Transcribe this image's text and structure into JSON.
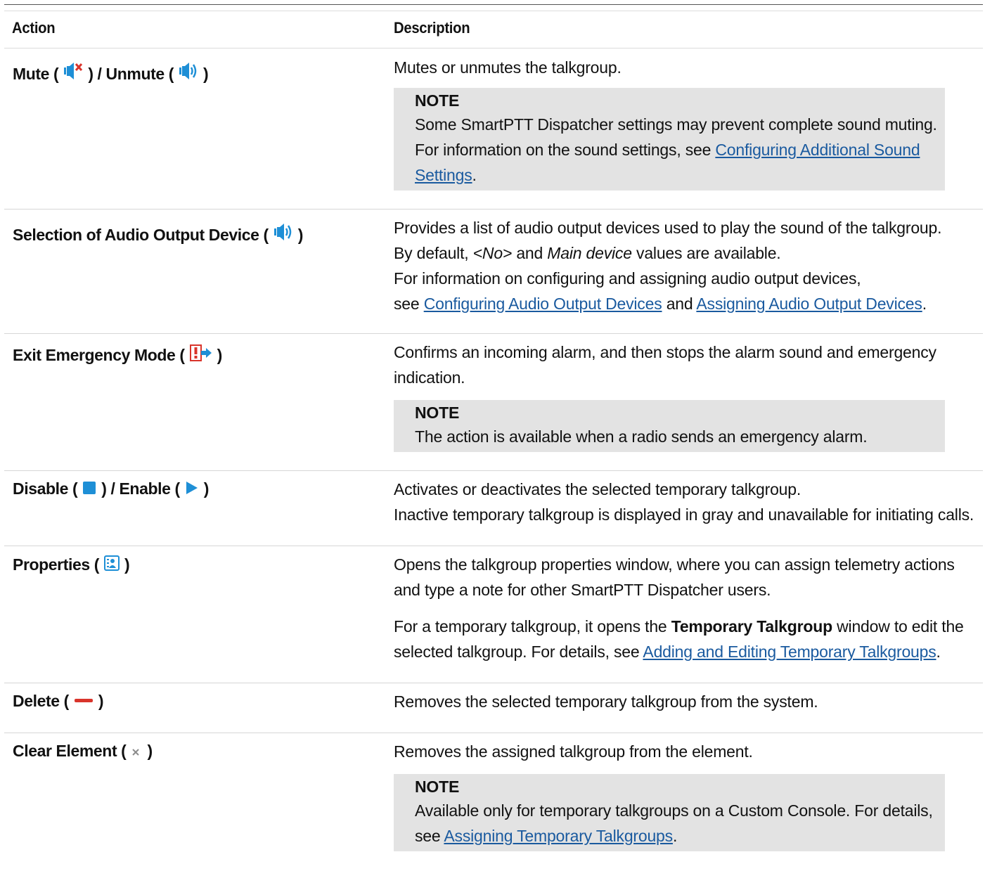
{
  "table": {
    "header": {
      "action": "Action",
      "description": "Description"
    },
    "rows": {
      "mute": {
        "action_a": "Mute (",
        "action_b": ") / Unmute (",
        "action_c": ")",
        "desc": "Mutes or unmutes the talkgroup.",
        "note_title": "NOTE",
        "note_text_1": "Some SmartPTT Dispatcher settings may prevent complete sound muting. For information on the sound settings, see ",
        "note_link": "Configuring Additional Sound Settings",
        "note_text_2": "."
      },
      "audio": {
        "action_a": "Selection of Audio Output Device (",
        "action_b": ")",
        "line1": "Provides a list of audio output devices used to play the sound of the talkgroup.",
        "line2_a": "By default, ",
        "line2_b": "<No>",
        "line2_c": " and ",
        "line2_d": "Main device",
        "line2_e": " values are available.",
        "line3": "For information on configuring and assigning audio output devices,",
        "line4_a": "see ",
        "link1": "Configuring Audio Output Devices",
        "line4_b": " and ",
        "link2": "Assigning Audio Output Devices",
        "line4_c": "."
      },
      "emergency": {
        "action_a": "Exit Emergency Mode (",
        "action_b": ")",
        "desc": "Confirms an incoming alarm, and then stops the alarm sound and emergency indication.",
        "note_title": "NOTE",
        "note_text": "The action is available when a radio sends an emergency alarm."
      },
      "disable": {
        "action_a": "Disable (",
        "action_b": ") / Enable (",
        "action_c": ")",
        "line1": "Activates or deactivates the selected temporary talkgroup.",
        "line2": "Inactive temporary talkgroup is displayed in gray and unavailable for initiating calls."
      },
      "properties": {
        "action_a": "Properties (",
        "action_b": ")",
        "para1": "Opens the talkgroup properties window, where you can assign telemetry actions and type a note for other SmartPTT Dispatcher users.",
        "para2_a": "For a temporary talkgroup, it opens the ",
        "para2_bold": "Temporary Talkgroup",
        "para2_b": " window to edit the selected talkgroup. For details, see ",
        "para2_link": "Adding and Editing Temporary Talkgroups",
        "para2_c": "."
      },
      "delete": {
        "action_a": "Delete (",
        "action_b": ")",
        "desc": "Removes the selected temporary talkgroup from the system."
      },
      "clear": {
        "action_a": "Clear Element (",
        "action_b": ")",
        "desc": "Removes the assigned talkgroup from the element.",
        "note_title": "NOTE",
        "note_text_1": "Available only for temporary talkgroups on a Custom Console. For details, see ",
        "note_link": "Assigning Temporary Talkgroups",
        "note_text_2": "."
      }
    }
  },
  "icons": {
    "mute": "speaker-muted-icon",
    "unmute": "speaker-icon",
    "audio_device": "speaker-icon",
    "exit_emergency": "exit-emergency-icon",
    "disable": "stop-square-icon",
    "enable": "play-triangle-icon",
    "properties": "properties-card-icon",
    "delete": "minus-bar-icon",
    "clear": "close-x-icon"
  },
  "colors": {
    "link": "#1a5a9f",
    "icon_blue": "#1e8fd6",
    "icon_red": "#d9342b",
    "note_bg": "#e3e3e3"
  }
}
